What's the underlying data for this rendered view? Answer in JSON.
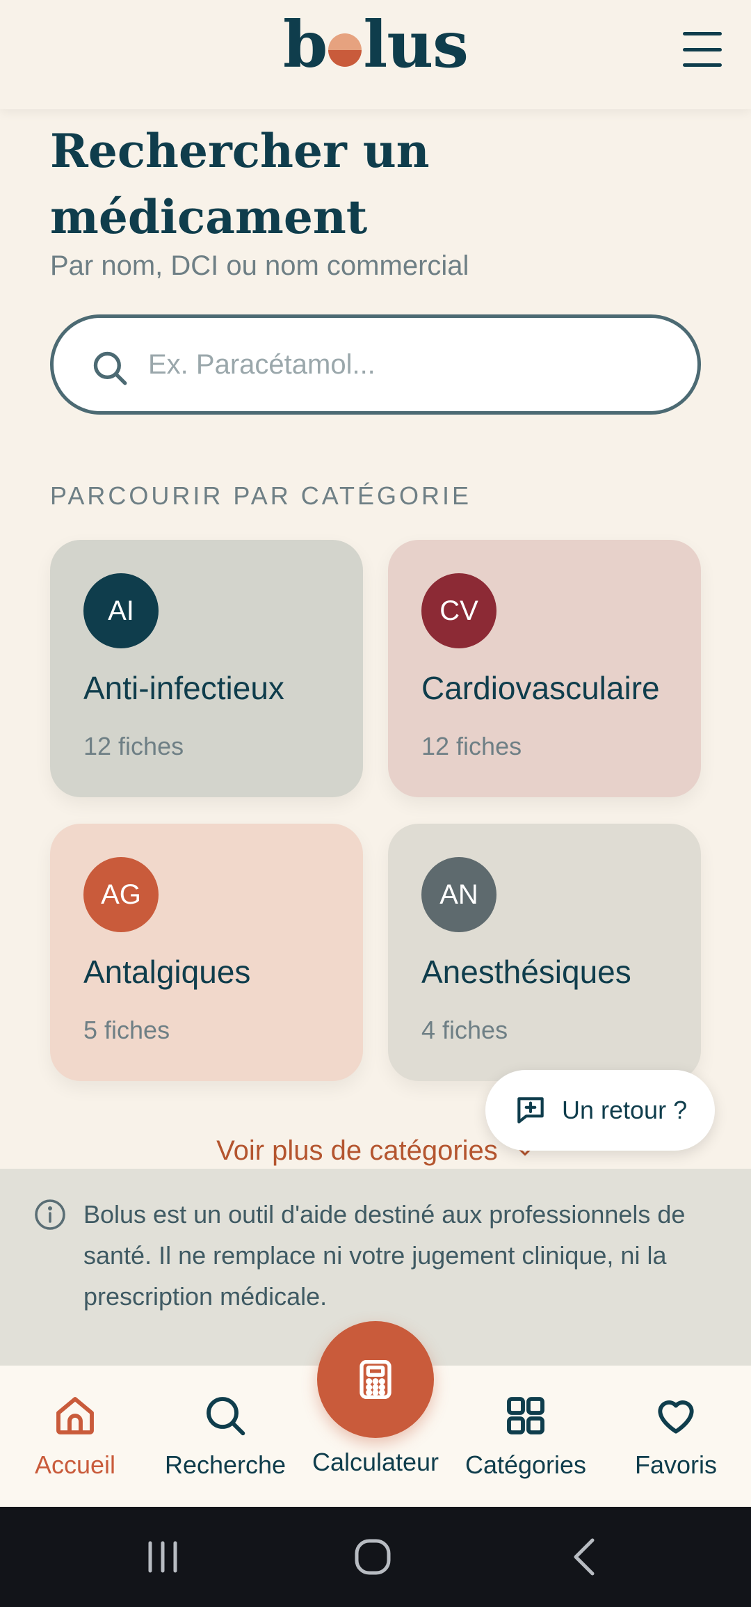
{
  "header": {
    "logo_left": "b",
    "logo_right": "lus",
    "logo_text": "bolus",
    "menu_icon": "hamburger-menu-icon"
  },
  "page": {
    "title": "Rechercher un médicament",
    "subtitle": "Par nom, DCI ou nom commercial"
  },
  "search": {
    "placeholder": "Ex. Paracétamol...",
    "value": ""
  },
  "categories": {
    "label": "PARCOURIR PAR CATÉGORIE",
    "items": [
      {
        "abbr": "AI",
        "name": "Anti-infectieux",
        "count": "12 fiches",
        "bg": "#D3D4CC",
        "badge": "#0F3D4C"
      },
      {
        "abbr": "CV",
        "name": "Cardiovasculaire",
        "count": "12 fiches",
        "bg": "#E7D1CA",
        "badge": "#8C2A35"
      },
      {
        "abbr": "AG",
        "name": "Antalgiques",
        "count": "5 fiches",
        "bg": "#F1D8CB",
        "badge": "#C95B3B"
      },
      {
        "abbr": "AN",
        "name": "Anesthésiques",
        "count": "4 fiches",
        "bg": "#DFDCD3",
        "badge": "#5E6A6E"
      }
    ],
    "more_label": "Voir plus de catégories"
  },
  "feedback": {
    "label": "Un retour ?"
  },
  "disclaimer": {
    "text": "Bolus est un outil d'aide destiné aux professionnels de santé. Il ne remplace ni votre jugement clinique, ni la prescription médicale."
  },
  "nav": {
    "items": [
      {
        "label": "Accueil",
        "icon": "home-icon",
        "active": true
      },
      {
        "label": "Recherche",
        "icon": "search-icon",
        "active": false
      },
      {
        "label": "Calculateur",
        "icon": "calculator-icon",
        "active": false
      },
      {
        "label": "Catégories",
        "icon": "grid-icon",
        "active": false
      },
      {
        "label": "Favoris",
        "icon": "heart-icon",
        "active": false
      }
    ]
  },
  "colors": {
    "background": "#F8F2E9",
    "primary": "#0F3D4C",
    "accent": "#C95B3B",
    "muted": "#6E7F85"
  }
}
